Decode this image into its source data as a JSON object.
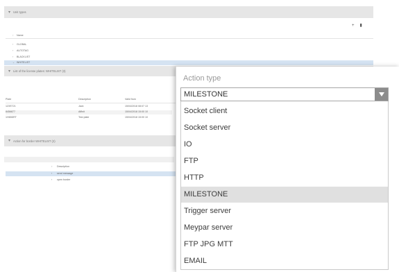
{
  "page": {
    "sections": [
      {
        "title": "Unit types"
      },
      {
        "title": "List of the license plates: WHITELIST (3)"
      },
      {
        "title": "Action for border WHITELIST (2)"
      }
    ],
    "toolbar": {
      "add_icon": "plus-icon",
      "delete_icon": "trash-icon"
    },
    "types_tree": {
      "header": "Name",
      "items": [
        "GLOBAL",
        "AUTOTAG",
        "BLACKLIST",
        "WHITELIST"
      ],
      "selected_index": 3
    },
    "plates_grid": {
      "columns": [
        "Plate",
        "Description",
        "Valid from"
      ],
      "rows": [
        [
          "123ST21",
          "Jack",
          "15/04/2018 08:07 13"
        ],
        [
          "8456877",
          "Affinit",
          "15/04/2018 15:00 10"
        ],
        [
          "1H65DRT",
          "Test plate",
          "15/04/2018 15:00 10"
        ]
      ]
    },
    "actions_tree": {
      "header": "Description",
      "items": [
        "send message",
        "open border"
      ],
      "selected_index": 0
    }
  },
  "overlay": {
    "label": "Action type",
    "selected_value": "MILESTONE",
    "arrow_icon": "chevron-down-icon",
    "options": [
      "Socket client",
      "Socket server",
      "IO",
      "FTP",
      "HTTP",
      "MILESTONE",
      "Trigger server",
      "Meypar server",
      "FTP JPG MTT",
      "EMAIL"
    ],
    "active_index": 5,
    "colors": {
      "arrow_bg": "#8c8c8c",
      "active_bg": "#e0e0e0",
      "selection_bg": "#d5e3f2"
    }
  }
}
